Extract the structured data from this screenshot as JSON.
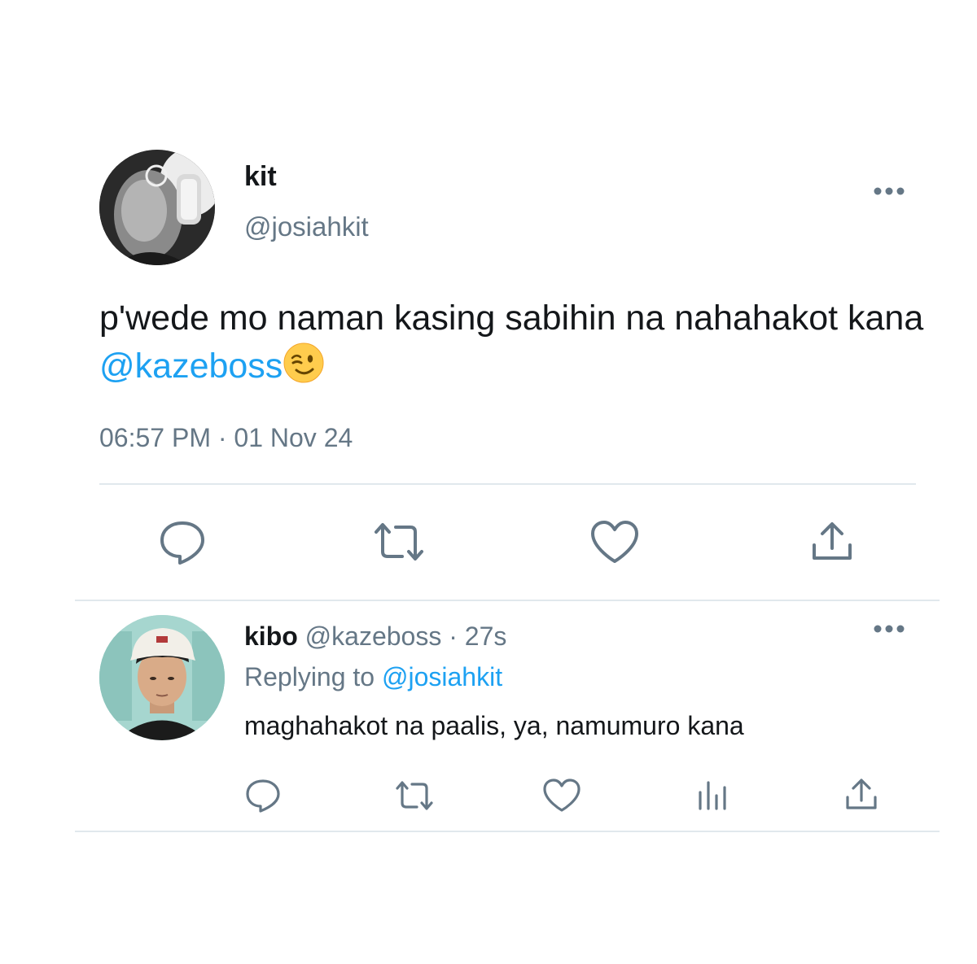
{
  "main_tweet": {
    "display_name": "kit",
    "handle": "@josiahkit",
    "text": "p'wede mo naman kasing sabihin na nahahakot kana ",
    "mention": "@kazeboss",
    "emoji": "wink-emoji",
    "timestamp": "06:57 PM · 01 Nov 24",
    "more_icon": "more-horizontal-icon",
    "actions": [
      "reply-icon",
      "retweet-icon",
      "like-icon",
      "share-icon"
    ]
  },
  "reply_tweet": {
    "display_name": "kibo",
    "handle": "@kazeboss",
    "time_ago": "· 27s",
    "replying_to_label": "Replying to",
    "replying_to_handle": "@josiahkit",
    "text": "maghahakot na paalis, ya, namumuro kana",
    "more_icon": "more-horizontal-icon",
    "actions": [
      "reply-icon",
      "retweet-icon",
      "like-icon",
      "analytics-icon",
      "share-icon"
    ]
  },
  "colors": {
    "text": "#14171a",
    "secondary": "#657786",
    "link": "#1da1f2",
    "divider": "#e1e8ed",
    "icon": "#657786"
  }
}
